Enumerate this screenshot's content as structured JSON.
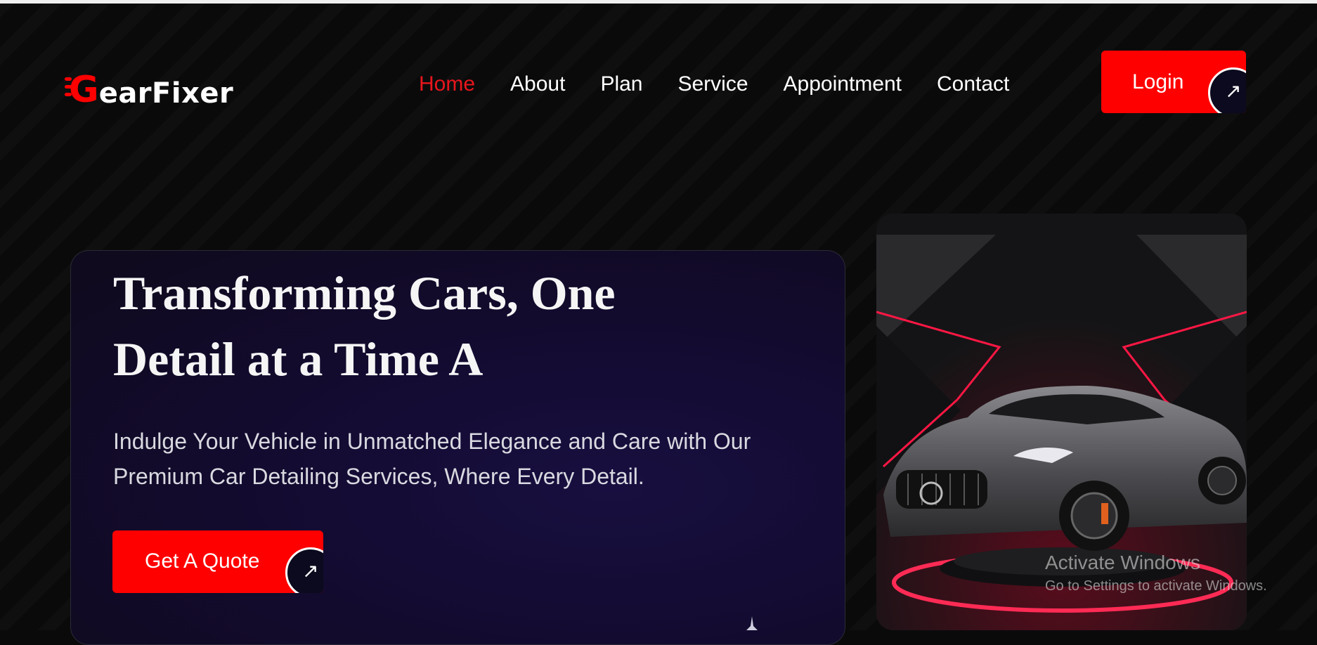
{
  "brand": {
    "logo_initial": "G",
    "logo_rest": "earFixer",
    "accent_color": "#ff0000"
  },
  "nav": {
    "items": [
      {
        "label": "Home",
        "active": true
      },
      {
        "label": "About",
        "active": false
      },
      {
        "label": "Plan",
        "active": false
      },
      {
        "label": "Service",
        "active": false
      },
      {
        "label": "Appointment",
        "active": false
      },
      {
        "label": "Contact",
        "active": false
      }
    ]
  },
  "header": {
    "login_label": "Login",
    "login_icon": "arrow-up-right-icon"
  },
  "hero": {
    "title_line1": "Transforming Cars, One",
    "title_line2": "Detail at a Time A",
    "subtitle_line1": "Indulge Your Vehicle in Unmatched Elegance and Care with Our",
    "subtitle_line2": "Premium Car Detailing Services, Where Every Detail.",
    "cta_label": "Get A Quote",
    "cta_icon": "arrow-up-right-icon"
  },
  "hero_image": {
    "icon": "sports-car-image"
  },
  "watermark": {
    "title": "Activate Windows",
    "subtitle": "Go to Settings to activate Windows."
  }
}
